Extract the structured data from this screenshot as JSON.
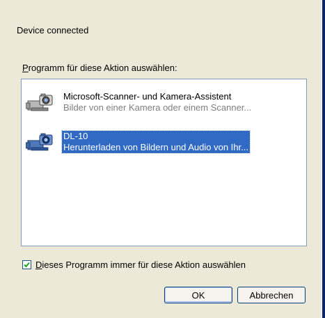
{
  "dialog": {
    "header": "Device connected",
    "list_label_accesskey": "P",
    "list_label_rest": "rogramm für diese Aktion auswählen:",
    "items": [
      {
        "title": "Microsoft-Scanner- und Kamera-Assistent",
        "subtitle": "Bilder von einer Kamera oder einem Scanner...",
        "icon": "camera-scanner-icon",
        "selected": false
      },
      {
        "title": "DL-10",
        "subtitle": "Herunterladen von Bildern und Audio von Ihr...",
        "icon": "camera-scanner-icon",
        "selected": true
      }
    ],
    "checkbox": {
      "accesskey": "D",
      "label_rest": "ieses Programm immer für diese Aktion auswählen",
      "checked": true
    },
    "buttons": {
      "ok_label": "OK",
      "cancel_label": "Abbrechen"
    }
  },
  "colors": {
    "background": "#ece9d8",
    "selection": "#316ac5",
    "button_border": "#003c74",
    "checkmark": "#21a121"
  }
}
